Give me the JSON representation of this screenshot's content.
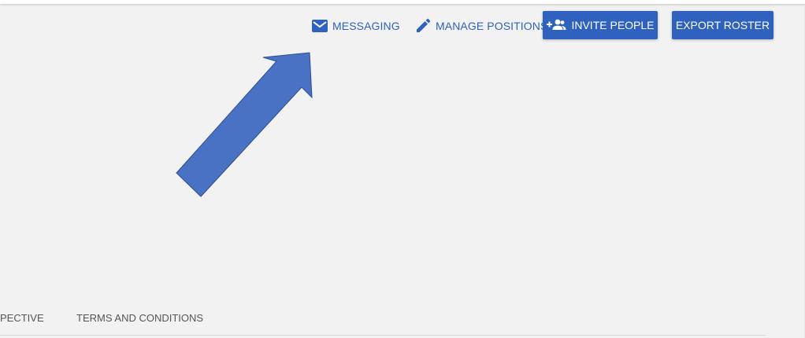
{
  "toolbar": {
    "messaging_label": "MESSAGING",
    "messaging_icon": "envelope-icon",
    "manage_positions_label": "MANAGE POSITIONS",
    "manage_positions_icon": "pencil-icon",
    "invite_people_label": "INVITE PEOPLE",
    "invite_people_icon": "add-person-icon",
    "export_roster_label": "EXPORT ROSTER"
  },
  "annotation": {
    "arrow_icon": "arrow-pointing-to-messaging",
    "arrow_color": "#4a72c4"
  },
  "footer": {
    "links": [
      {
        "label": "PECTIVE"
      },
      {
        "label": "TERMS AND CONDITIONS"
      }
    ]
  },
  "colors": {
    "accent": "#2f62bf",
    "background": "#f2f2f2",
    "footer_text": "#555555"
  }
}
